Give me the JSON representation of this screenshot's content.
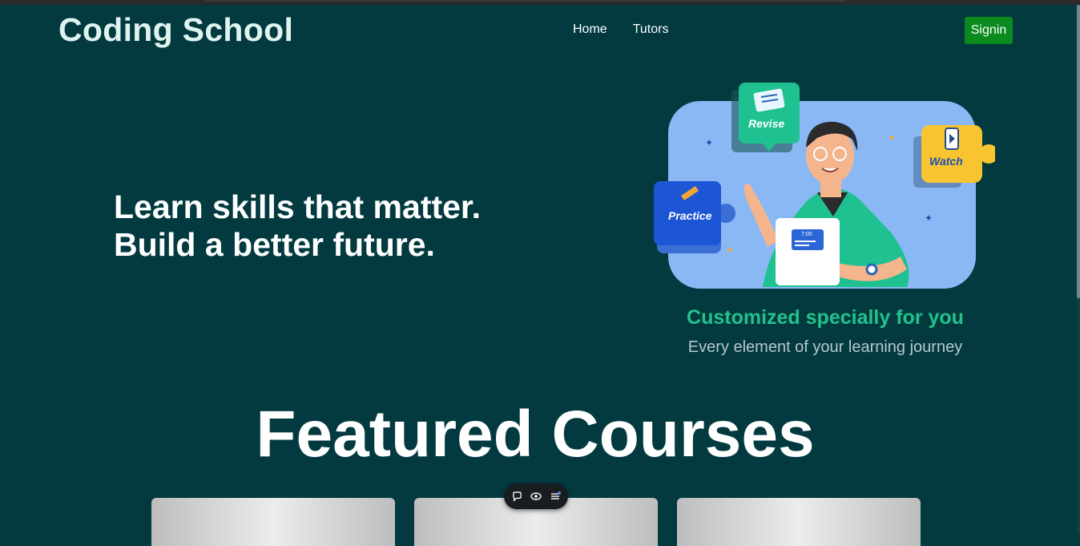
{
  "navbar": {
    "brand": "Coding School",
    "links": [
      {
        "label": "Home"
      },
      {
        "label": "Tutors"
      }
    ],
    "signin_label": "Signin"
  },
  "hero": {
    "line1": "Learn skills that matter.",
    "line2": "Build a better future.",
    "illustration": {
      "tags": [
        "Revise",
        "Watch",
        "Practice"
      ],
      "clock": "7:00",
      "title": "Customized specially for you",
      "subtitle": "Every element of your learning journey"
    }
  },
  "featured": {
    "title": "Featured Courses",
    "card_count": 3
  },
  "toolbar": {
    "icons": [
      "comment-icon",
      "eye-icon",
      "menu-icon"
    ]
  },
  "colors": {
    "background": "#023a3f",
    "signin": "#0a8a1f",
    "accent_green": "#22c28a",
    "illustration_bg": "#8ab8f5"
  }
}
